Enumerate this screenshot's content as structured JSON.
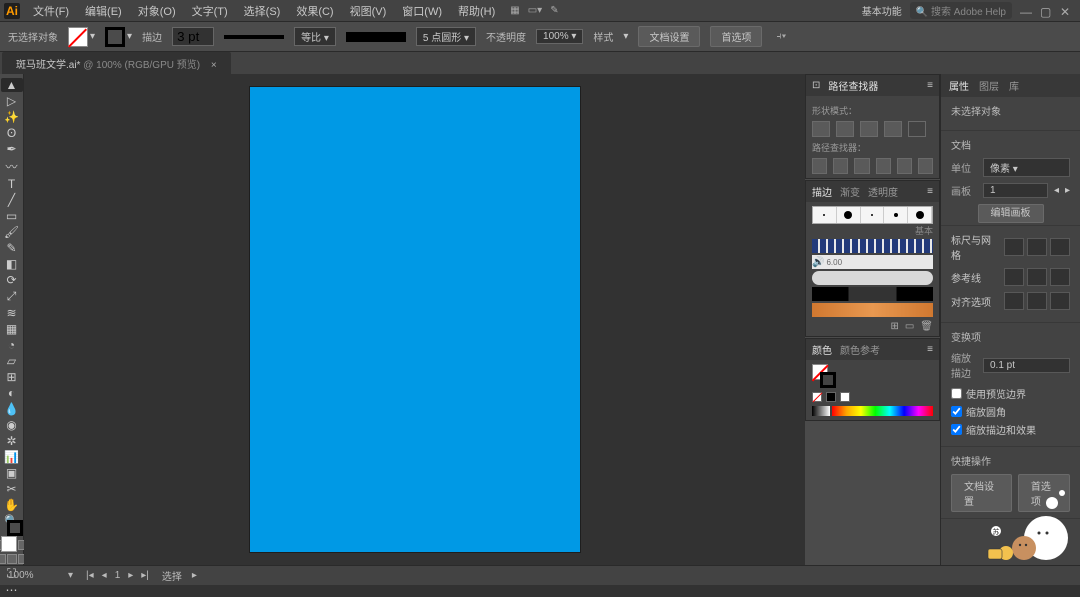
{
  "menubar": {
    "items": [
      "文件(F)",
      "编辑(E)",
      "对象(O)",
      "文字(T)",
      "选择(S)",
      "效果(C)",
      "视图(V)",
      "窗口(W)",
      "帮助(H)"
    ],
    "workspace_label": "基本功能",
    "search_placeholder": "搜索 Adobe Help"
  },
  "optionbar": {
    "noselection_label": "无选择对象",
    "stroke_label": "描边",
    "stroke_weight": "3 pt",
    "stroke_profile": "等比",
    "corner_label": "5 点圆形",
    "opacity_label": "不透明度",
    "opacity_value": "100%",
    "style_label": "样式",
    "btn_docsetup": "文档设置",
    "btn_prefs": "首选项"
  },
  "document": {
    "tab_name": "斑马班文学.ai*",
    "zoom_inline": "100%",
    "colormode": "(RGB/GPU 预览)"
  },
  "right": {
    "pathfinder_title": "路径查找器",
    "shapemodes_label": "形状模式：",
    "pathfinder_label": "路径查找器：",
    "panel_tabs_a": [
      "描边",
      "渐变",
      "透明度"
    ],
    "brush_width_label": "6.00",
    "panel_tabs_b": [
      "颜色",
      "颜色参考"
    ],
    "swatch_fill_lbl": "填",
    "swatch_grp_lbls": [
      "无",
      "黑",
      "白"
    ]
  },
  "prop": {
    "tabs": [
      "属性",
      "图层",
      "库"
    ],
    "section1": "未选择对象",
    "section2": "文档",
    "unit_label": "单位",
    "unit_value": "像素",
    "artboard_label": "画板",
    "artboard_value": "1",
    "btn_artboard_edit": "编辑画板",
    "section3": "标尺与网格",
    "section4": "参考线",
    "section5": "对齐选项",
    "section6": "变换项",
    "scale_label": "缩放描边",
    "scale_value": "0.1 pt",
    "chk1": "使用预览边界",
    "chk2": "缩放圆角",
    "chk3": "缩放描边和效果",
    "section7": "快捷操作",
    "btn_docsetup": "文档设置",
    "btn_prefs": "首选项"
  },
  "statusbar": {
    "zoom": "100%",
    "sel_label": "选择"
  }
}
